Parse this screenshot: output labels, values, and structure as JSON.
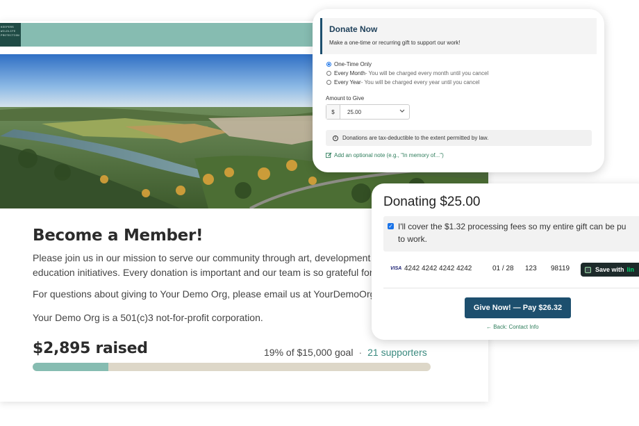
{
  "org": {
    "logo_lines": [
      "KEEPERS",
      "WILDLIFE",
      "PROTECTION"
    ]
  },
  "member": {
    "title": "Become a Member!",
    "line1": "Please join us in our mission to serve our community through art, development pro",
    "line2": "education initiatives. Every donation is important and our team is so grateful for yo",
    "line3": "For questions about giving to Your Demo Org, please email us at YourDemoOrg@e",
    "line4": "Your Demo Org is a 501(c)3 not-for-profit corporation."
  },
  "campaign": {
    "raised": "$2,895 raised",
    "goal_text": "19% of $15,000 goal",
    "separator": "·",
    "supporters": "21 supporters",
    "progress_fraction": 0.19
  },
  "donate": {
    "title": "Donate Now",
    "subtitle": "Make a one-time or recurring gift to support our work!",
    "options": [
      {
        "label": "One-Time Only",
        "note": "",
        "selected": true
      },
      {
        "label": "Every Month",
        "note": " - You will be charged every month until you cancel",
        "selected": false
      },
      {
        "label": "Every Year",
        "note": " - You will be charged every year until you cancel",
        "selected": false
      }
    ],
    "amount_label": "Amount to Give",
    "currency": "$",
    "amount_value": "25.00",
    "tax_note": "Donations are tax-deductible to the extent permitted by law.",
    "note_link": "Add an optional note (e.g., \"In memory of...\")"
  },
  "payment": {
    "title": "Donating $25.00",
    "fee_line1": "I'll cover the $1.32 processing fees so my entire gift can be pu",
    "fee_line2": "to work.",
    "card_brand": "VISA",
    "card_number": "4242 4242 4242 4242",
    "card_expiry": "01 / 28",
    "card_cvc": "123",
    "card_zip": "98119",
    "link_label": "Save with",
    "link_brand": "lin",
    "give_button": "Give Now! — Pay $26.32",
    "back_link": "← Back: Contact Info"
  },
  "colors": {
    "brand_teal": "#86bcb1",
    "button_navy": "#1d4f6e",
    "link_green": "#2e7d5b"
  }
}
